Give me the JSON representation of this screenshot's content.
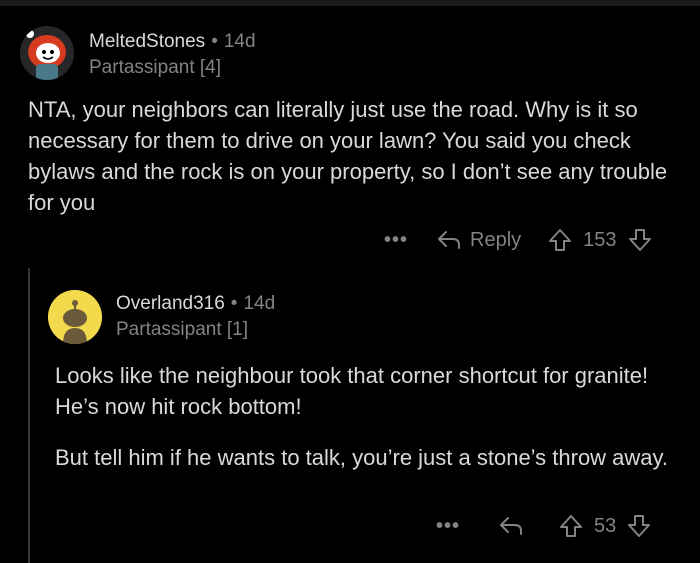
{
  "comments": [
    {
      "username": "MeltedStones",
      "age": "14d",
      "flair": "Partassipant [4]",
      "body": "NTA, your neighbors can literally just use the road. Why is it so necessary for them to drive on your lawn? You said you check bylaws and the rock is on your property, so I don’t see any trouble for you",
      "more": "•••",
      "reply_label": "Reply",
      "score": "153"
    },
    {
      "username": "Overland316",
      "age": "14d",
      "flair": "Partassipant [1]",
      "body_p1": "Looks like the neighbour took that corner shortcut for granite! He’s now hit rock bottom!",
      "body_p2": "But tell him if he wants to talk, you’re just a stone’s throw away.",
      "more": "•••",
      "score": "53"
    }
  ],
  "colors": {
    "background": "#000000",
    "text": "#d7dadc",
    "meta": "#818384",
    "avatar1_bg": "#d63a1f",
    "avatar2_bg": "#f3d94c"
  },
  "icons": [
    "snoo-avatar-red-hair-icon",
    "snoo-avatar-default-icon",
    "reply-arrow-icon",
    "upvote-arrow-icon",
    "downvote-arrow-icon"
  ]
}
